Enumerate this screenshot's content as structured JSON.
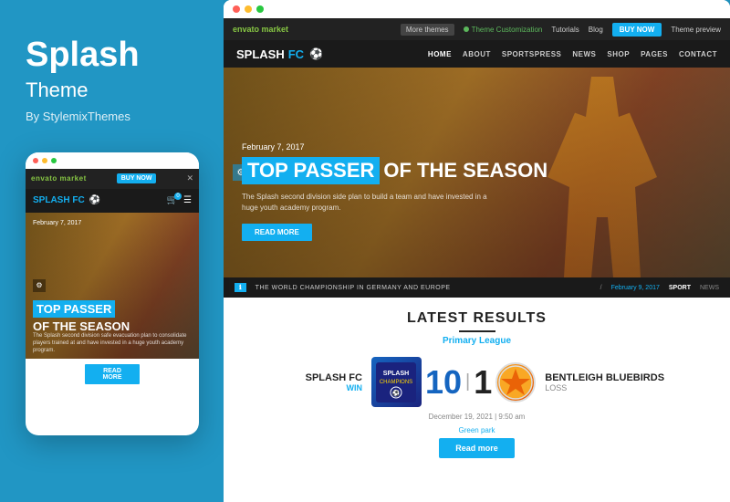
{
  "left": {
    "title": "Splash",
    "subtitle": "Theme",
    "by": "By StylemixThemes",
    "mobile": {
      "envato_logo": "envato market",
      "buy_now": "BUY NOW",
      "close": "✕",
      "logo": "SPLASH",
      "logo_accent": "FC",
      "soccer_icon": "⚽",
      "cart_badge": "0",
      "date": "February 7, 2017",
      "headline_blue": "TOP PASSER",
      "headline_white": "OF THE SEASON",
      "body_text": "The Splash second division safe evacuation plan to consolidate players trained at and have invested in a huge youth academy program.",
      "read_more": "READ MORE",
      "settings_icon": "⚙"
    }
  },
  "right": {
    "desktop": {
      "envato_logo": "envato market",
      "more_themes": "More themes",
      "theme_custom_text": "Theme Customization",
      "tutorials": "Tutorials",
      "blog": "Blog",
      "buy_now": "BUY NOW",
      "theme_preview": "Theme preview",
      "site_logo": "SPLASH",
      "site_logo_accent": "FC",
      "soccer_icon": "⚽",
      "nav": [
        "HOME",
        "ABOUT",
        "SPORTSPRESS",
        "NEWS",
        "SHOP",
        "PAGES",
        "CONTACT"
      ],
      "hero_date": "February 7, 2017",
      "headline_blue": "TOP PASSER",
      "headline_white": "OF THE SEASON",
      "hero_desc": "The Splash second division side plan to build a team and have invested in a huge youth academy program.",
      "read_more": "READ MORE",
      "settings_icon": "⚙",
      "news_bar_text": "THE WORLD CHAMPIONSHIP IN GERMANY AND EUROPE",
      "news_bar_date": "February 9, 2017",
      "news_bar_sport": "SPORT",
      "news_bar_news": "NEWS"
    },
    "results": {
      "title": "LATEST RESULTS",
      "league": "Primary League",
      "team_left_name": "SPLASH FC",
      "team_left_result": "WIN",
      "score_left": "10",
      "score_right": "1",
      "team_right_name": "BENTLEIGH BLUEBIRDS",
      "team_right_result": "LOSS",
      "badge_line1": "SPLASH",
      "badge_line2": "CHAMPIONS",
      "match_date": "December 19, 2021 | 9:50 am",
      "match_venue": "Green park",
      "read_more": "Read more"
    }
  }
}
